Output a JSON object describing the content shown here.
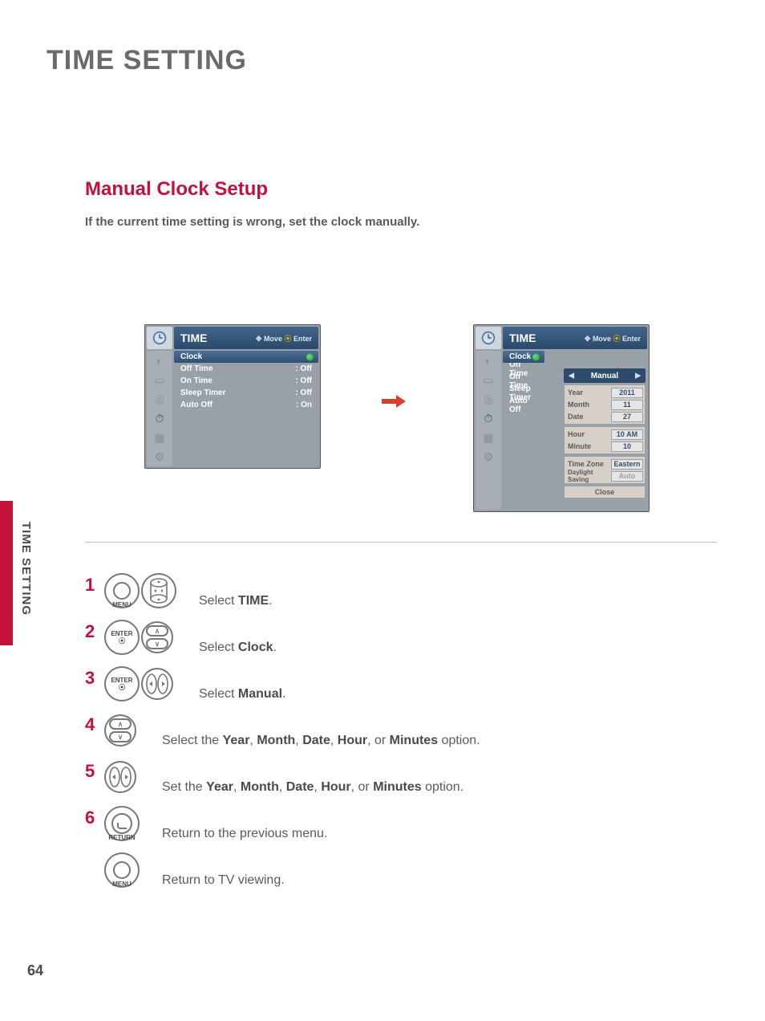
{
  "page_title": "TIME SETTING",
  "side_label": "TIME SETTING",
  "page_number": "64",
  "section_title": "Manual Clock Setup",
  "intro_text": "If the current time setting is wrong, set the clock manually.",
  "osd": {
    "title": "TIME",
    "hint_move": "Move",
    "hint_enter": "Enter"
  },
  "osd_left": {
    "rows": [
      {
        "label": "Clock",
        "value": null,
        "selected": true
      },
      {
        "label": "Off Time",
        "value": "Off",
        "selected": false
      },
      {
        "label": "On Time",
        "value": "Off",
        "selected": false
      },
      {
        "label": "Sleep Timer",
        "value": "Off",
        "selected": false
      },
      {
        "label": "Auto Off",
        "value": "On",
        "selected": false
      }
    ]
  },
  "osd_right": {
    "rows": [
      {
        "label": "Clock",
        "selected": true
      },
      {
        "label": "Off Time",
        "selected": false
      },
      {
        "label": "On Time",
        "selected": false
      },
      {
        "label": "Sleep Timer",
        "selected": false
      },
      {
        "label": "Auto Off",
        "selected": false
      }
    ],
    "mode_value": "Manual",
    "fields": {
      "year": {
        "label": "Year",
        "value": "2011"
      },
      "month": {
        "label": "Month",
        "value": "11"
      },
      "date": {
        "label": "Date",
        "value": "27"
      },
      "hour": {
        "label": "Hour",
        "value": "10 AM"
      },
      "minute": {
        "label": "Minute",
        "value": "10"
      },
      "tz": {
        "label": "Time Zone",
        "value": "Eastern"
      },
      "dst": {
        "label": "Daylight Saving",
        "value": "Auto"
      }
    },
    "close_label": "Close"
  },
  "buttons": {
    "menu": "MENU",
    "enter": "ENTER",
    "return": "RETURN"
  },
  "steps": [
    {
      "n": "1",
      "text_pre": "Select ",
      "bold": "TIME",
      "text_post": "."
    },
    {
      "n": "2",
      "text_pre": "Select ",
      "bold": "Clock",
      "text_post": "."
    },
    {
      "n": "3",
      "text_pre": "Select ",
      "bold": "Manual",
      "text_post": "."
    },
    {
      "n": "4",
      "text_full": "Select the <b>Year</b>, <b>Month</b>, <b>Date</b>, <b>Hour</b>, or <b>Minutes</b> option."
    },
    {
      "n": "5",
      "text_full": "Set the <b>Year</b>, <b>Month</b>, <b>Date</b>, <b>Hour</b>, or <b>Minutes</b> option."
    },
    {
      "n": "6",
      "text_full": "Return to the previous menu."
    },
    {
      "n": "",
      "text_full": "Return to TV viewing."
    }
  ]
}
